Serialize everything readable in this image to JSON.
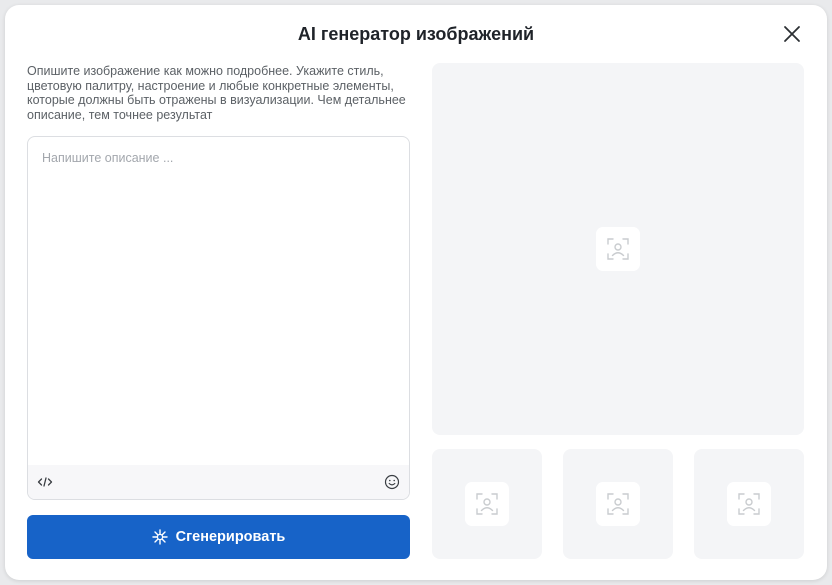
{
  "modal": {
    "title": "AI генератор изображений",
    "close_icon": "close-icon"
  },
  "form": {
    "description": "Опишите изображение как можно подробнее. Укажите стиль, цветовую палитру, настроение и любые конкретные элементы, которые должны быть отражены в визуализации. Чем детальнее описание, тем точнее результат",
    "prompt_placeholder": "Напишите описание ...",
    "prompt_value": "",
    "toolbar_icons": [
      "code-icon",
      "emoji-icon"
    ],
    "generate_label": "Сгенерировать",
    "generate_icon": "sparkle-icon"
  },
  "previews": {
    "main_icon": "image-placeholder-icon",
    "thumbnails": [
      "image-placeholder-icon",
      "image-placeholder-icon",
      "image-placeholder-icon"
    ]
  },
  "colors": {
    "accent": "#1763c8",
    "preview_bg": "#f4f5f7",
    "text_muted": "#5c6166"
  }
}
